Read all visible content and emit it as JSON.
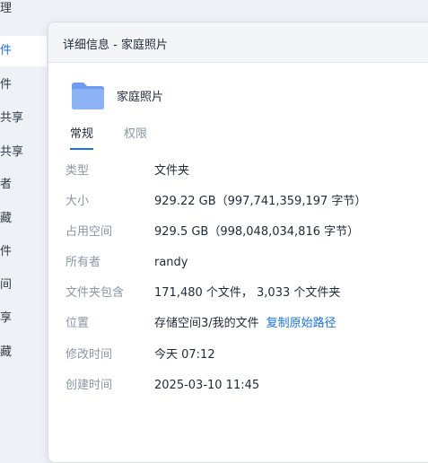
{
  "sidebar": {
    "header": "理",
    "items": [
      {
        "label": "件",
        "active": true
      },
      {
        "label": "件",
        "active": false
      },
      {
        "label": "共享",
        "active": false
      },
      {
        "label": "共享",
        "active": false
      },
      {
        "label": "者",
        "active": false
      },
      {
        "label": "藏",
        "active": false
      },
      {
        "label": "件",
        "active": false
      },
      {
        "label": "间",
        "active": false
      },
      {
        "label": "享",
        "active": false
      },
      {
        "label": "藏",
        "active": false
      }
    ]
  },
  "dialog": {
    "title": "详细信息 - 家庭照片",
    "item_icon": "folder-icon",
    "item_name": "家庭照片",
    "tabs": [
      {
        "label": "常规",
        "active": true
      },
      {
        "label": "权限",
        "active": false
      }
    ],
    "properties": {
      "type": {
        "label": "类型",
        "value": "文件夹"
      },
      "size": {
        "label": "大小",
        "value": "929.22 GB（997,741,359,197 字节）"
      },
      "used": {
        "label": "占用空间",
        "value": "929.5 GB（998,048,034,816 字节）"
      },
      "owner": {
        "label": "所有者",
        "value": "randy"
      },
      "contains": {
        "label": "文件夹包含",
        "value": "171,480 个文件， 3,033 个文件夹"
      },
      "location": {
        "label": "位置",
        "value": "存储空间3/我的文件",
        "link": "复制原始路径"
      },
      "modified": {
        "label": "修改时间",
        "value": "今天 07:12"
      },
      "created": {
        "label": "创建时间",
        "value": "2025-03-10 11:45"
      }
    }
  },
  "colors": {
    "accent": "#1a73e8",
    "folder": "#8db3f4",
    "label": "#8a96a8"
  }
}
